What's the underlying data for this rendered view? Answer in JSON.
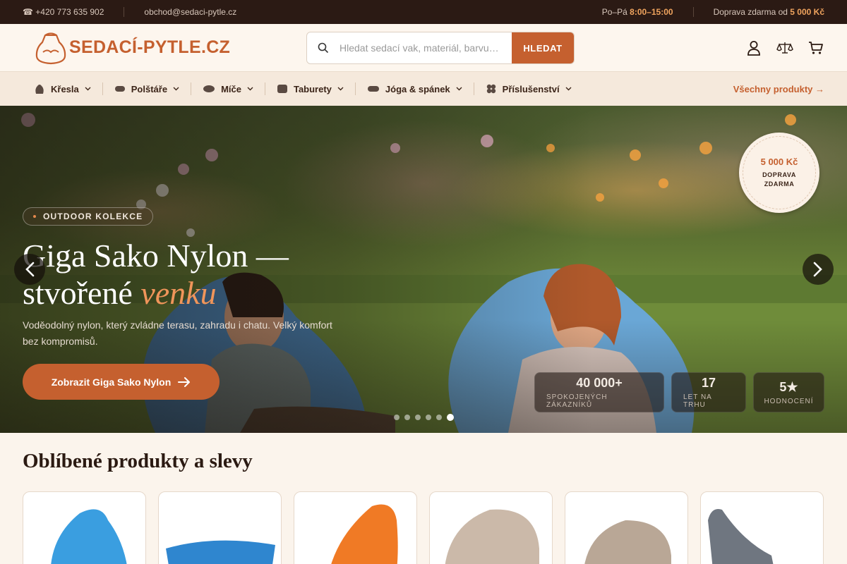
{
  "topbar": {
    "phone": "☎ +420 773 635 902",
    "email": "obchod@sedaci-pytle.cz",
    "hours_label": "Po–Pá",
    "hours_value": "8:00–15:00",
    "shipping_label": "Doprava zdarma od",
    "shipping_value": "5 000 Kč"
  },
  "header": {
    "logo_text": "SEDACÍ-PYTLE.CZ",
    "search_placeholder": "Hledat sedací vak, materiál, barvu…",
    "search_button": "HLEDAT",
    "icons": [
      "user-icon",
      "compare-scale-icon",
      "cart-icon"
    ]
  },
  "nav": {
    "items": [
      {
        "label": "Křesla",
        "icon": "armchair-icon"
      },
      {
        "label": "Polštáře",
        "icon": "pillow-icon"
      },
      {
        "label": "Míče",
        "icon": "ball-icon"
      },
      {
        "label": "Taburety",
        "icon": "stool-icon"
      },
      {
        "label": "Jóga & spánek",
        "icon": "yoga-mat-icon"
      },
      {
        "label": "Příslušenství",
        "icon": "accessory-icon"
      }
    ],
    "all_products": "Všechny produkty →"
  },
  "hero": {
    "badge": "OUTDOOR KOLEKCE",
    "title_line1": "Giga Sako Nylon —",
    "title_line2": "stvořené",
    "title_em": "venku",
    "description": "Voděodolný nylon, který zvládne terasu, zahradu i chatu. Velký komfort bez kompromisů.",
    "cta": "Zobrazit Giga Sako Nylon",
    "seal_price": "5 000 Kč",
    "seal_text1": "DOPRAVA",
    "seal_text2": "ZDARMA",
    "stats": [
      {
        "value": "40 000+",
        "label": "SPOKOJENÝCH ZÁKAZNÍKŮ"
      },
      {
        "value": "17",
        "label": "LET NA TRHU"
      },
      {
        "value": "5★",
        "label": "HODNOCENÍ"
      }
    ],
    "slides_total": 6,
    "slide_active": 6
  },
  "section": {
    "title": "Oblíbené produkty a slevy"
  },
  "colors": {
    "brand": "#c5602f",
    "topbar_bg": "#2b1a14",
    "page_bg": "#fbf4ec"
  }
}
